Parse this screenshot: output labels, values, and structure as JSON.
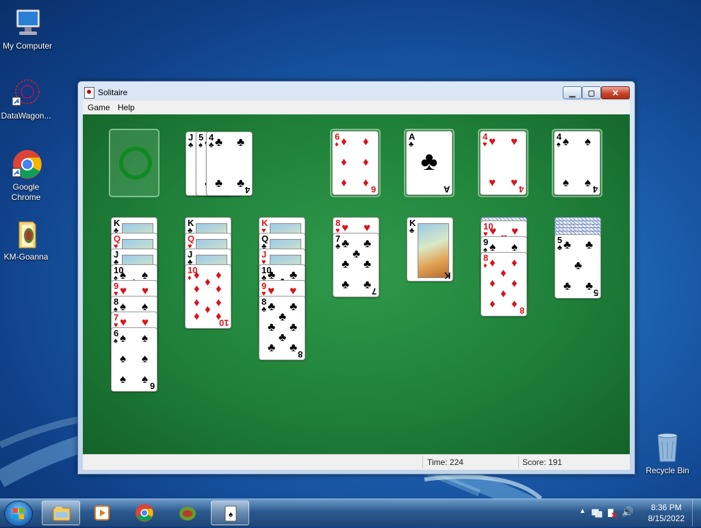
{
  "desktop": {
    "icons": [
      {
        "label": "My Computer",
        "icon": "computer-icon"
      },
      {
        "label": "DataWagon...",
        "icon": "datawagon-icon"
      },
      {
        "label": "Google Chrome",
        "icon": "chrome-icon"
      },
      {
        "label": "KM-Goanna",
        "icon": "folder-icon"
      },
      {
        "label": "Recycle Bin",
        "icon": "recycle-bin-icon"
      }
    ]
  },
  "window": {
    "title": "Solitaire",
    "menu": [
      "Game",
      "Help"
    ],
    "status": {
      "time": "Time:  224",
      "score": "Score: 191"
    }
  },
  "game": {
    "stock": "empty-recycle",
    "waste": [
      {
        "rank": "J",
        "suit": "♣",
        "color": "black"
      },
      {
        "rank": "5",
        "suit": "♠",
        "color": "black"
      },
      {
        "rank": "4",
        "suit": "♣",
        "color": "black"
      }
    ],
    "foundations": [
      {
        "rank": "6",
        "suit": "♦",
        "color": "red"
      },
      {
        "rank": "A",
        "suit": "♣",
        "color": "black"
      },
      {
        "rank": "4",
        "suit": "♥",
        "color": "red"
      },
      {
        "rank": "4",
        "suit": "♠",
        "color": "black"
      }
    ],
    "tableau": [
      {
        "hidden": 0,
        "cards": [
          {
            "rank": "K",
            "suit": "♣",
            "color": "black"
          },
          {
            "rank": "Q",
            "suit": "♥",
            "color": "red"
          },
          {
            "rank": "J",
            "suit": "♣",
            "color": "black"
          },
          {
            "rank": "10",
            "suit": "♠",
            "color": "black"
          },
          {
            "rank": "9",
            "suit": "♥",
            "color": "red"
          },
          {
            "rank": "8",
            "suit": "♠",
            "color": "black"
          },
          {
            "rank": "7",
            "suit": "♥",
            "color": "red"
          },
          {
            "rank": "6",
            "suit": "♠",
            "color": "black"
          }
        ]
      },
      {
        "hidden": 0,
        "cards": [
          {
            "rank": "K",
            "suit": "♣",
            "color": "black"
          },
          {
            "rank": "Q",
            "suit": "♥",
            "color": "red"
          },
          {
            "rank": "J",
            "suit": "♣",
            "color": "black"
          },
          {
            "rank": "10",
            "suit": "♦",
            "color": "red"
          }
        ]
      },
      {
        "hidden": 0,
        "cards": [
          {
            "rank": "K",
            "suit": "♥",
            "color": "red"
          },
          {
            "rank": "Q",
            "suit": "♣",
            "color": "black"
          },
          {
            "rank": "J",
            "suit": "♥",
            "color": "red"
          },
          {
            "rank": "10",
            "suit": "♣",
            "color": "black"
          },
          {
            "rank": "9",
            "suit": "♥",
            "color": "red"
          },
          {
            "rank": "8",
            "suit": "♣",
            "color": "black"
          }
        ]
      },
      {
        "hidden": 0,
        "cards": [
          {
            "rank": "8",
            "suit": "♥",
            "color": "red"
          },
          {
            "rank": "7",
            "suit": "♣",
            "color": "black"
          }
        ]
      },
      {
        "hidden": 0,
        "cards": [
          {
            "rank": "K",
            "suit": "♣",
            "color": "black"
          }
        ]
      },
      {
        "hidden": 1,
        "cards": [
          {
            "rank": "10",
            "suit": "♥",
            "color": "red"
          },
          {
            "rank": "9",
            "suit": "♠",
            "color": "black"
          },
          {
            "rank": "8",
            "suit": "♦",
            "color": "red"
          }
        ]
      },
      {
        "hidden": 5,
        "cards": [
          {
            "rank": "5",
            "suit": "♣",
            "color": "black"
          }
        ]
      }
    ]
  },
  "taskbar": {
    "pinned": [
      "explorer-icon",
      "media-player-icon",
      "chrome-icon",
      "goanna-icon",
      "solitaire-icon"
    ],
    "clock": {
      "time": "8:36 PM",
      "date": "8/15/2022"
    }
  }
}
